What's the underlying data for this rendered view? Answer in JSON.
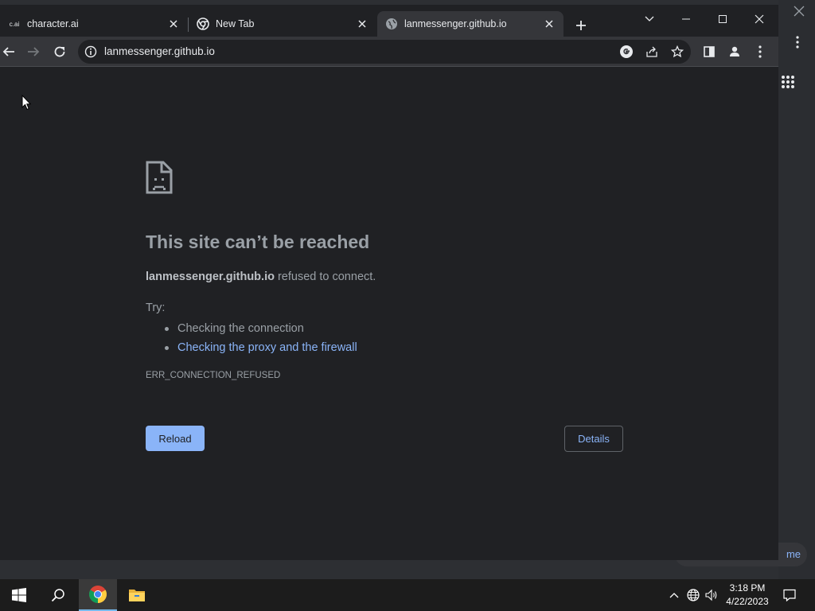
{
  "tabs": [
    {
      "favicon_text": "c.ai",
      "title": "character.ai",
      "active": false
    },
    {
      "favicon": "chrome-icon",
      "title": "New Tab",
      "active": false
    },
    {
      "favicon": "globe-icon",
      "title": "lanmessenger.github.io",
      "active": true
    }
  ],
  "omnibox": {
    "url": "lanmessenger.github.io"
  },
  "error": {
    "headline": "This site can’t be reached",
    "host": "lanmessenger.github.io",
    "message": " refused to connect.",
    "try_label": "Try:",
    "suggestions": [
      "Checking the connection",
      "Checking the proxy and the firewall"
    ],
    "code": "ERR_CONNECTION_REFUSED",
    "reload_label": "Reload",
    "details_label": "Details"
  },
  "background_window": {
    "pill_text": "me"
  },
  "taskbar": {
    "time": "3:18 PM",
    "date": "4/22/2023"
  },
  "colors": {
    "accent": "#8ab4f8",
    "page_bg": "#202124",
    "toolbar_bg": "#35363a",
    "taskbar_bg": "#1c1c1c"
  }
}
